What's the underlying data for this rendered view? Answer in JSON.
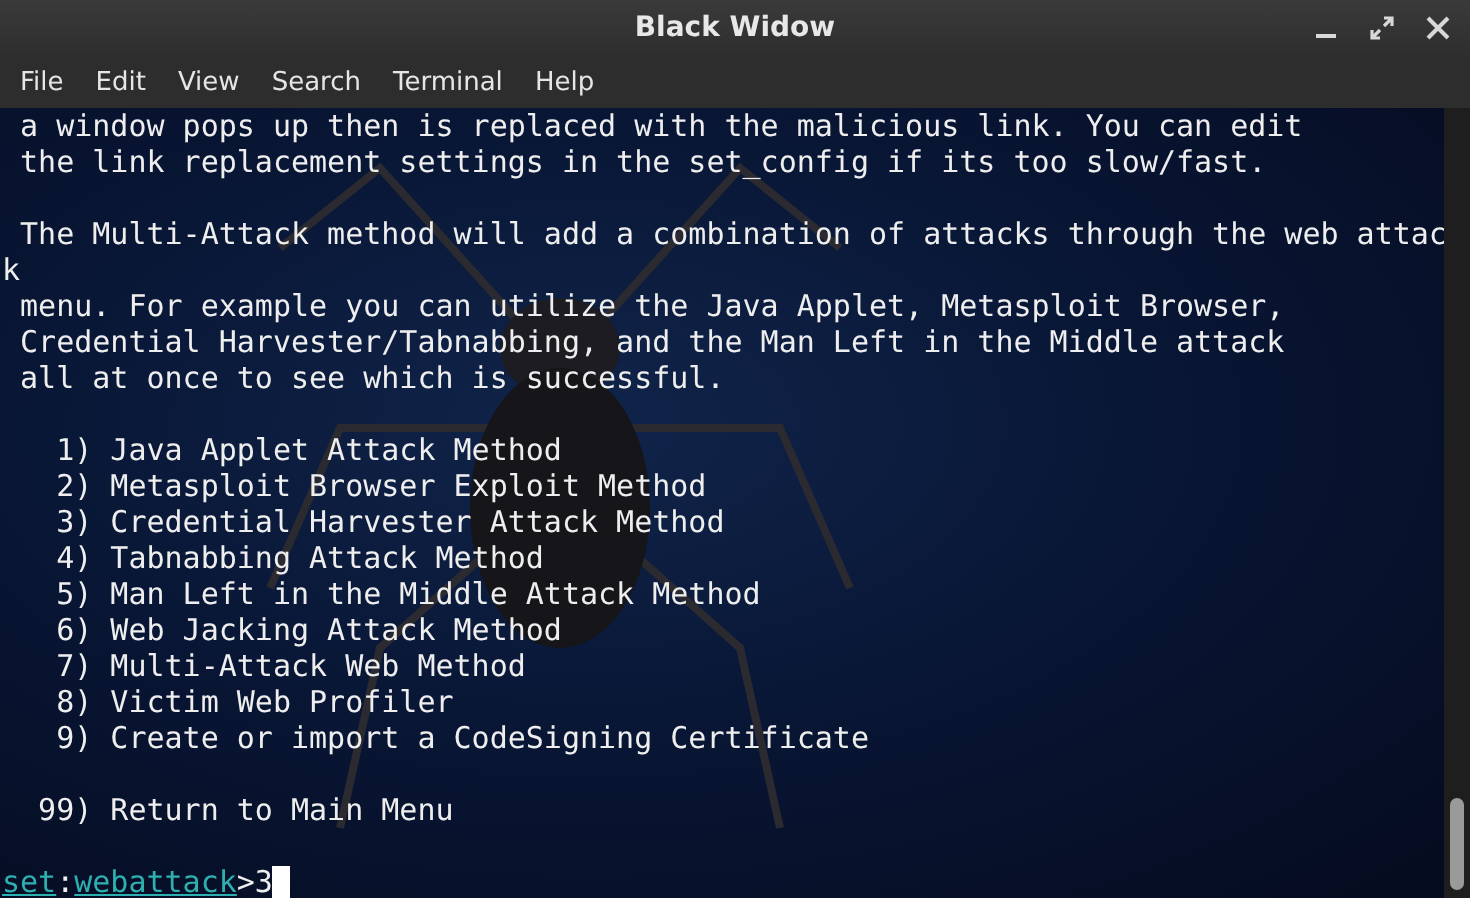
{
  "window": {
    "title": "Black Widow"
  },
  "menu": [
    "File",
    "Edit",
    "View",
    "Search",
    "Terminal",
    "Help"
  ],
  "lines": [
    {
      "kind": "text",
      "text": " a window pops up then is replaced with the malicious link. You can edit"
    },
    {
      "kind": "text",
      "text": " the link replacement settings in the set_config if its too slow/fast."
    },
    {
      "kind": "blank"
    },
    {
      "kind": "text",
      "text": " The Multi-Attack method will add a combination of attacks through the web attac"
    },
    {
      "kind": "text",
      "text": "k"
    },
    {
      "kind": "text",
      "text": " menu. For example you can utilize the Java Applet, Metasploit Browser,"
    },
    {
      "kind": "text",
      "text": " Credential Harvester/Tabnabbing, and the Man Left in the Middle attack"
    },
    {
      "kind": "text",
      "text": " all at once to see which is successful."
    },
    {
      "kind": "blank"
    },
    {
      "kind": "text",
      "text": "   1) Java Applet Attack Method"
    },
    {
      "kind": "text",
      "text": "   2) Metasploit Browser Exploit Method"
    },
    {
      "kind": "text",
      "text": "   3) Credential Harvester Attack Method"
    },
    {
      "kind": "text",
      "text": "   4) Tabnabbing Attack Method"
    },
    {
      "kind": "text",
      "text": "   5) Man Left in the Middle Attack Method"
    },
    {
      "kind": "text",
      "text": "   6) Web Jacking Attack Method"
    },
    {
      "kind": "text",
      "text": "   7) Multi-Attack Web Method"
    },
    {
      "kind": "text",
      "text": "   8) Victim Web Profiler"
    },
    {
      "kind": "text",
      "text": "   9) Create or import a CodeSigning Certificate"
    },
    {
      "kind": "blank"
    },
    {
      "kind": "text",
      "text": "  99) Return to Main Menu"
    },
    {
      "kind": "blank"
    }
  ],
  "prompt": {
    "module": "set",
    "separator": ":",
    "context": "webattack",
    "symbol": ">",
    "input": "3"
  }
}
